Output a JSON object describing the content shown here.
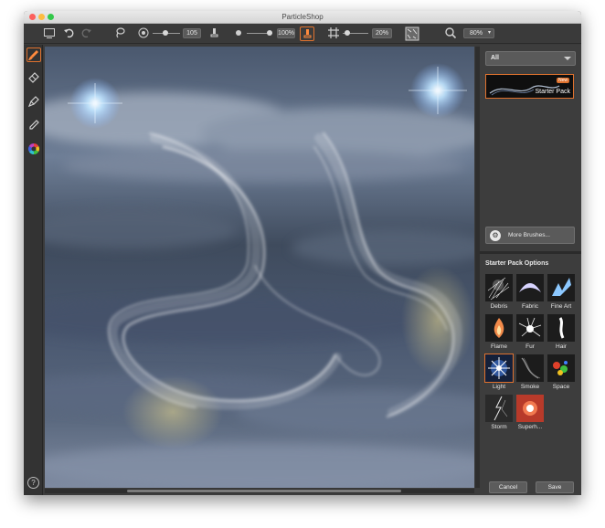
{
  "window": {
    "title": "ParticleShop"
  },
  "toolbar": {
    "brush_size": "105",
    "opacity": "100%",
    "grid_value": "20%",
    "zoom": "80%"
  },
  "left_tools": {
    "help_label": "?"
  },
  "right_panel": {
    "category": "All",
    "pack_name": "Starter Pack",
    "pack_badge": "New",
    "more_brushes": "More Brushes...",
    "options_title": "Starter Pack Options",
    "brushes": [
      {
        "label": "Debris"
      },
      {
        "label": "Fabric"
      },
      {
        "label": "Fine Art"
      },
      {
        "label": "Flame"
      },
      {
        "label": "Fur"
      },
      {
        "label": "Hair"
      },
      {
        "label": "Light"
      },
      {
        "label": "Smoke"
      },
      {
        "label": "Space"
      },
      {
        "label": "Storm"
      },
      {
        "label": "Superh..."
      }
    ],
    "cancel_label": "Cancel",
    "save_label": "Save"
  },
  "colors": {
    "accent": "#e0722e",
    "panel": "#3d3d3d"
  }
}
